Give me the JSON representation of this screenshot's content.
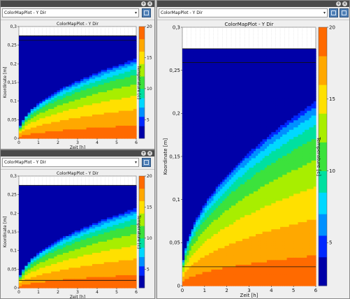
{
  "panels": [
    {
      "selector_value": "ColorMapPlot - Y Dir",
      "chart_data": {
        "type": "heatmap",
        "title": "ColorMapPlot - Y Dir",
        "xlabel": "Zeit [h]",
        "ylabel": "Koordinate [m]",
        "xlim": [
          0,
          6
        ],
        "ylim": [
          0,
          0.3
        ],
        "x_ticks": [
          "0",
          "1",
          "2",
          "3",
          "4",
          "5",
          "6"
        ],
        "y_ticks": [
          "0",
          "0,05",
          "0,1",
          "0,15",
          "0,2",
          "0,25",
          "0,3"
        ],
        "colorbar_label": "Temperature [c]",
        "colorbar_ticks": [
          "5",
          "10",
          "15",
          "20"
        ],
        "colorbar_range": [
          2,
          20
        ],
        "filled_region_top": 0.275,
        "horizontal_lines_y": [
          0.275,
          0.263
        ]
      }
    },
    {
      "selector_value": "ColorMapPlot - Y Dir",
      "chart_data": {
        "type": "heatmap",
        "title": "ColorMapPlot - Y Dir",
        "xlabel": "Zeit [h]",
        "ylabel": "Koordinate [m]",
        "xlim": [
          0,
          6
        ],
        "ylim": [
          0,
          0.3
        ],
        "x_ticks": [
          "0",
          "1",
          "2",
          "3",
          "4",
          "5",
          "6"
        ],
        "y_ticks": [
          "0",
          "0,05",
          "0,1",
          "0,15",
          "0,2",
          "0,25",
          "0,3"
        ],
        "colorbar_label": "Temperature [c]",
        "colorbar_ticks": [
          "5",
          "10",
          "15",
          "20"
        ],
        "colorbar_range": [
          2,
          20
        ],
        "filled_region_top": 0.275,
        "horizontal_lines_y": [
          0.02
        ]
      }
    },
    {
      "selector_value": "ColorMapPlot - Y Dir",
      "chart_data": {
        "type": "heatmap",
        "title": "ColorMapPlot - Y Dir",
        "xlabel": "Zeit [h]",
        "ylabel": "Koordinate [m]",
        "xlim": [
          0,
          6
        ],
        "ylim": [
          0,
          0.3
        ],
        "x_ticks": [
          "0",
          "1",
          "2",
          "3",
          "4",
          "5",
          "6"
        ],
        "y_ticks": [
          "0",
          "0,05",
          "0,1",
          "0,15",
          "0,2",
          "0,25",
          "0,3"
        ],
        "colorbar_label": "Temperature [c]",
        "colorbar_ticks": [
          "5",
          "10",
          "15",
          "20"
        ],
        "colorbar_range": [
          2,
          20
        ],
        "filled_region_top": 0.275,
        "horizontal_lines_y": [
          0.259,
          0.022
        ]
      }
    }
  ],
  "colors": {
    "bands": [
      "#0000a8",
      "#0028ff",
      "#0090ff",
      "#00d8ff",
      "#00e0a0",
      "#3ce23c",
      "#a8ee00",
      "#ffe000",
      "#ffa800",
      "#ff6a00"
    ],
    "band_min_temps": [
      2,
      4,
      5.5,
      7,
      8.5,
      10,
      12,
      14,
      16,
      18
    ]
  },
  "icons": {
    "float_button": "float-icon",
    "close_button": "close-icon",
    "dock_toggle": "dock-toggle-icon",
    "settings": "settings-icon"
  }
}
